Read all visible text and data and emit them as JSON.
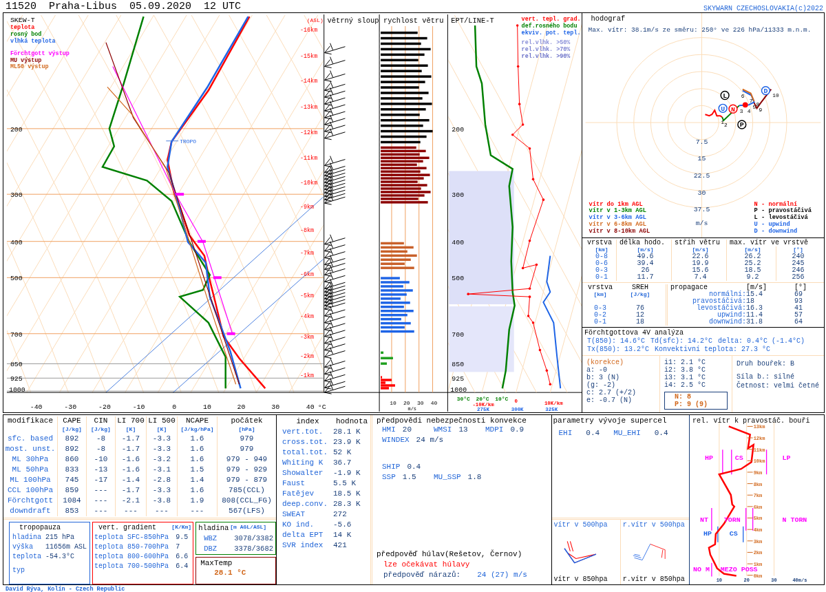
{
  "header": {
    "station": "11520",
    "place": "Praha-Libus",
    "date": "05.09.2020",
    "time": "12 UTC",
    "credit": "SKYWARN CZECHOSLOVAKIA(c)2022"
  },
  "skew_t": {
    "title": "SKEW-T",
    "legend": [
      {
        "label": "teplota",
        "color": "#ff0000"
      },
      {
        "label": "rosný bod",
        "color": "#008000"
      },
      {
        "label": "vlhká teplota",
        "color": "#1e64e6"
      },
      {
        "label": "Förchtgott výstup",
        "color": "#ff00ff"
      },
      {
        "label": "MU výstup",
        "color": "#8b0000"
      },
      {
        "label": "ML50 výstup",
        "color": "#d2691e"
      }
    ],
    "asl": "(ASL)",
    "heights": [
      "-16km",
      "-15km",
      "-14km",
      "-13km",
      "-12km",
      "-11km",
      "-10km",
      "-9km",
      "-8km",
      "-7km",
      "-6km",
      "-5km",
      "-4km",
      "-3km",
      "-2km",
      "-1km"
    ],
    "pressures": [
      "200",
      "300",
      "400",
      "500",
      "700",
      "850",
      "925",
      "1000"
    ],
    "temperatures": [
      "-40",
      "-30",
      "-20",
      "-10",
      "0",
      "10",
      "20",
      "30",
      "40"
    ],
    "unit": "°C",
    "tropopause_label": "TROPO"
  },
  "wind_column": {
    "title": "větrný sloup"
  },
  "wind_speed": {
    "title": "rychlost větru",
    "ticks": [
      "10",
      "20",
      "30",
      "40"
    ],
    "unit": "m/s"
  },
  "ept": {
    "title": "EPT/LINE-T",
    "legend": [
      {
        "label": "vert. tepl. grad.",
        "color": "#ff0000"
      },
      {
        "label": "def.rosného bodu",
        "color": "#008000"
      },
      {
        "label": "ekviv. pot. tepl.",
        "color": "#1e64e6"
      },
      {
        "label": "rel.vlhk. >50%",
        "color": "#8a90d8"
      },
      {
        "label": "rel.vlhk. >70%",
        "color": "#7a80d0"
      },
      {
        "label": "rel.vlhk. >90%",
        "color": "#6a70c8"
      }
    ],
    "pressures": [
      "200",
      "300",
      "400",
      "500",
      "700",
      "850",
      "925",
      "1000"
    ],
    "dewpoint_ticks": [
      "30°C",
      "20°C",
      "10°C"
    ],
    "gradient_ticks": [
      "-10K/km",
      "0",
      "10K/km"
    ],
    "ept_ticks": [
      "275K",
      "300K",
      "325K"
    ]
  },
  "hodograph": {
    "title": "hodograf",
    "max_wind": "Max. vítr: 38.1m/s ze směru: 250° ve 226 hPa/11333 m.n.m.",
    "rings": [
      "7.5",
      "15",
      "22.5",
      "30",
      "37.5"
    ],
    "unit": "m/s",
    "markers": [
      {
        "label": "L",
        "color": "#000000"
      },
      {
        "label": "U",
        "color": "#1e64e6"
      },
      {
        "label": "N",
        "color": "#ff0000"
      },
      {
        "label": "P",
        "color": "#000000"
      },
      {
        "label": "D",
        "color": "#1e64e6"
      }
    ],
    "point_labels": [
      "1",
      "2",
      "3",
      "4",
      "5",
      "6",
      "7",
      "8",
      "9",
      "10"
    ],
    "layers": [
      {
        "label": "vítr do 1km AGL",
        "color": "#ff0000"
      },
      {
        "label": "vítr v 1-3km AGL",
        "color": "#008000"
      },
      {
        "label": "vítr v 3-6km AGL",
        "color": "#1e64e6"
      },
      {
        "label": "vítr v 6-8km AGL",
        "color": "#d2691e"
      },
      {
        "label": "vítr v 8-10km AGL",
        "color": "#8b0000"
      }
    ],
    "motions": [
      {
        "label": "N - normální",
        "color": "#ff0000"
      },
      {
        "label": "P - pravostáčivá",
        "color": "#000000"
      },
      {
        "label": "L - levostáčivá",
        "color": "#000000"
      },
      {
        "label": "U - upwind",
        "color": "#1e64e6"
      },
      {
        "label": "D - downwind",
        "color": "#1e64e6"
      }
    ]
  },
  "shear": {
    "titles": [
      "vrstva",
      "délka hodo.",
      "střih větru",
      "max. vítr ve vrstvě"
    ],
    "units": [
      "[km]",
      "[m/s]",
      "[m/s]",
      "[m/s]",
      "[°]"
    ],
    "rows": [
      [
        "0-8",
        "49.6",
        "22.6",
        "26.2",
        "240"
      ],
      [
        "0-6",
        "39.4",
        "19.9",
        "25.2",
        "245"
      ],
      [
        "0-3",
        "26",
        "15.6",
        "18.5",
        "246"
      ],
      [
        "0-1",
        "11.7",
        "7.4",
        "9.2",
        "256"
      ]
    ]
  },
  "sreh": {
    "titles": [
      "vrstva",
      "SREH"
    ],
    "units": [
      "[km]",
      "[J/kg]"
    ],
    "rows": [
      [
        "0-3",
        "76"
      ],
      [
        "0-2",
        "12"
      ],
      [
        "0-1",
        "18"
      ]
    ]
  },
  "propagation": {
    "titles": [
      "propagace",
      "[m/s]",
      "[°]"
    ],
    "rows": [
      [
        "normální:",
        "15.4",
        "69"
      ],
      [
        "pravostáčivá:",
        "18",
        "93"
      ],
      [
        "levostáčivá:",
        "16.3",
        "41"
      ],
      [
        "upwind:",
        "11.4",
        "57"
      ],
      [
        "downwind:",
        "31.8",
        "64"
      ]
    ]
  },
  "forchtgott": {
    "title": "Förchtgottova 4V analýza",
    "lines": [
      [
        "T(850): 14.6°C",
        "Td(sfc): 14.2°C",
        "delta: 0.4°C (-1.4°C)"
      ],
      [
        "Tx(850): 13.2°C",
        "Konvektivní teplota: 27.3 °C"
      ]
    ],
    "correction_title": "(korekce)",
    "corrections": [
      "a: -0",
      "b: 3 (N)",
      "(g: -2)",
      "c: 2.7 (+/2)",
      "e: -0.7 (N)"
    ],
    "intervals": [
      "i1: 2.1 °C",
      "i2: 3.8 °C",
      "i3: 3.1 °C",
      "i4: 2.5 °C"
    ],
    "result": [
      "N: 8",
      "P: 9 (9)"
    ],
    "storm": [
      "Druh bouřek: B",
      "Síla b.: silné",
      "Četnost: velmi četné"
    ]
  },
  "modifications": {
    "columns": [
      {
        "title": "modifikace"
      },
      {
        "title": "CAPE",
        "unit": "[J/kg]"
      },
      {
        "title": "CIN",
        "unit": "[J/kg]"
      },
      {
        "title": "LI 700",
        "unit": "[K]"
      },
      {
        "title": "LI 500",
        "unit": "[K]"
      },
      {
        "title": "NCAPE",
        "unit": "[J/kg/hPa]"
      },
      {
        "title": "počátek",
        "unit": "[hPa]"
      }
    ],
    "rows": [
      [
        "sfc. based",
        "892",
        "-8",
        "-1.7",
        "-3.3",
        "1.6",
        "979"
      ],
      [
        "most. unst.",
        "892",
        "-8",
        "-1.7",
        "-3.3",
        "1.6",
        "979"
      ],
      [
        "ML 30hPa",
        "860",
        "-10",
        "-1.6",
        "-3.2",
        "1.6",
        "979 - 949"
      ],
      [
        "ML 50hPa",
        "833",
        "-13",
        "-1.6",
        "-3.1",
        "1.5",
        "979 - 929"
      ],
      [
        "ML 100hPa",
        "745",
        "-17",
        "-1.4",
        "-2.8",
        "1.4",
        "979 - 879"
      ],
      [
        "CCL 100hPa",
        "859",
        "---",
        "-1.7",
        "-3.3",
        "1.6",
        "785(CCL)"
      ],
      [
        "Förchtgott",
        "1084",
        "---",
        "-2.1",
        "-3.8",
        "1.9",
        "808(CCL_FG)"
      ],
      [
        "downdraft",
        "853",
        "---",
        "---",
        "---",
        "---",
        "567(LFS)"
      ]
    ]
  },
  "tropopause": {
    "title": "tropopauza",
    "rows": [
      [
        "hladina",
        "215 hPa"
      ],
      [
        "výška",
        "11656m ASL"
      ],
      [
        "teplota",
        "-54.3°C"
      ],
      [
        "typ"
      ]
    ]
  },
  "vertical_gradient": {
    "title": "vert. gradient",
    "unit": "[K/Km]",
    "rows": [
      [
        "teplota SFC-850hPa",
        "9.5"
      ],
      [
        "teplota 850-700hPa",
        "7"
      ],
      [
        "teplota 800-600hPa",
        "6.6"
      ],
      [
        "teplota 700-500hPa",
        "6.4"
      ]
    ]
  },
  "levels": {
    "title": "hladina",
    "unit": "[m AGL/ASL]",
    "rows": [
      [
        "WBZ",
        "3078/3382"
      ],
      [
        "DBZ",
        "3378/3682"
      ]
    ]
  },
  "max_temp": {
    "title": "MaxTemp",
    "value": "28.1 °C"
  },
  "indices": {
    "columns": [
      "index",
      "hodnota"
    ],
    "rows": [
      [
        "vert.tot.",
        "28.1 K"
      ],
      [
        "cross.tot.",
        "23.9 K"
      ],
      [
        "total.tot.",
        "52 K"
      ],
      [
        "Whiting K",
        "36.7"
      ],
      [
        "Showalter",
        "-1.9 K"
      ],
      [
        "Faust",
        "5.5 K"
      ],
      [
        "Fatějev",
        "18.5 K"
      ],
      [
        "deep.conv.",
        "28.3 K"
      ],
      [
        "SWEAT",
        "272"
      ],
      [
        "KO ind.",
        "-5.6"
      ],
      [
        "delta EPT",
        "14 K"
      ],
      [
        "SVR index",
        "421"
      ]
    ]
  },
  "convection": {
    "title": "předpovědi nebezpečnosti konvekce",
    "rows": [
      [
        [
          "HMI",
          "20"
        ],
        [
          "WMSI",
          "13"
        ],
        [
          "MDPI",
          "0.9"
        ]
      ],
      [
        [
          "WINDEX",
          "24 m/s"
        ]
      ],
      [
        [
          "SHIP",
          "0.4"
        ]
      ],
      [
        [
          "SSP",
          "1.5"
        ],
        [
          "MU_SSP",
          "1.8"
        ]
      ]
    ]
  },
  "hail": {
    "title": "předpověď húlav(Rešetov, Černov)",
    "warning": "lze očekávat húlavy",
    "gust_label": "předpověď nárazů:",
    "gust_value": "24 (27) m/s"
  },
  "supercell": {
    "title": "parametry vývoje supercel",
    "rows": [
      [
        "EHI",
        "0.4"
      ],
      [
        "MU_EHI",
        "0.4"
      ]
    ],
    "wind_500": "vítr v 500hpa",
    "wind_850": "vítr v 850hpa",
    "rel_500": "r.vítr v 500hpa",
    "rel_850": "r.vítr v 850hpa"
  },
  "relative_wind": {
    "title": "rel. vítr k pravostáč. bouři",
    "heights": [
      "13km",
      "12km",
      "11km",
      "10km",
      "9km",
      "8km",
      "7km",
      "6km",
      "5km",
      "4km",
      "3km",
      "2km",
      "1km",
      "0km"
    ],
    "speed_ticks": [
      "10",
      "20",
      "30",
      "40m/s"
    ],
    "zones": [
      {
        "label": "HP",
        "color": "#ff00ff"
      },
      {
        "label": "CS",
        "color": "#ff00ff"
      },
      {
        "label": "LP",
        "color": "#ff00ff"
      },
      {
        "label": "NT",
        "color": "#ff00ff"
      },
      {
        "label": "TORN",
        "color": "#ff00ff"
      },
      {
        "label": "N TORN",
        "color": "#ff00ff"
      },
      {
        "label": "HP",
        "color": "#1e64e6"
      },
      {
        "label": "CS",
        "color": "#1e64e6"
      },
      {
        "label": "NO M",
        "color": "#ff00ff"
      },
      {
        "label": "MEZO POSS",
        "color": "#ff00ff"
      }
    ]
  },
  "footer": "David Rýva, Kolín - Czech Republic"
}
